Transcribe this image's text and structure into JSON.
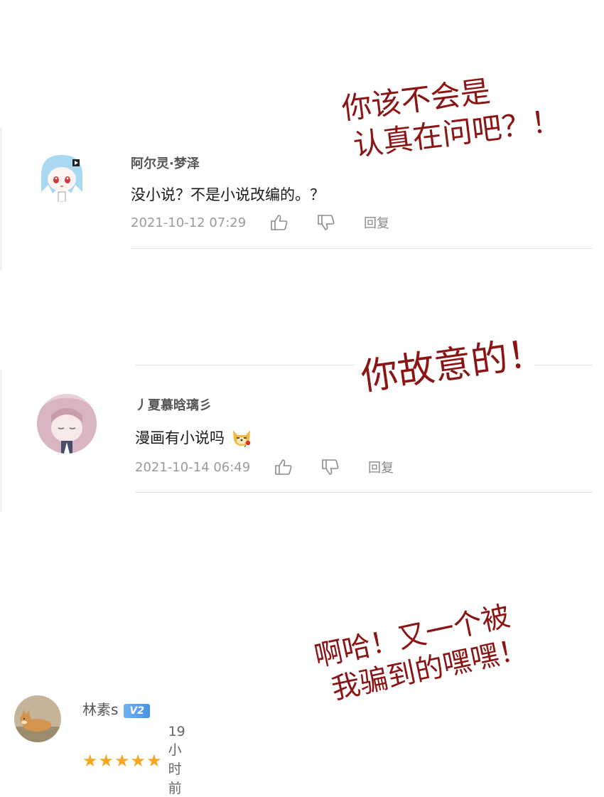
{
  "comments": [
    {
      "username": "阿尔灵·梦泽",
      "text": "没小说？不是小说改编的。？",
      "timestamp": "2021-10-12 07:29",
      "reply_label": "回复"
    },
    {
      "username": "丿夏慕晗璃彡",
      "text": "漫画有小说吗",
      "timestamp": "2021-10-14 06:49",
      "reply_label": "回复"
    },
    {
      "username": "林素s",
      "badge": "V2",
      "time_ago": "19小时前",
      "rating_stars": 5
    }
  ],
  "annotations": [
    {
      "line1": "你该不会是",
      "line2": "认真在问吧？！"
    },
    {
      "line1": "你故意的！"
    },
    {
      "line1": "啊哈！又一个被",
      "line2": "我骗到的嘿嘿！"
    }
  ],
  "colors": {
    "annotation": "#8b1414",
    "star": "#f5a623",
    "badge": "#4a90e2",
    "meta_text": "#9a9a9a"
  },
  "icons": [
    "thumbs-up-icon",
    "thumbs-down-icon",
    "emoji-dog-icon",
    "star-icon"
  ]
}
